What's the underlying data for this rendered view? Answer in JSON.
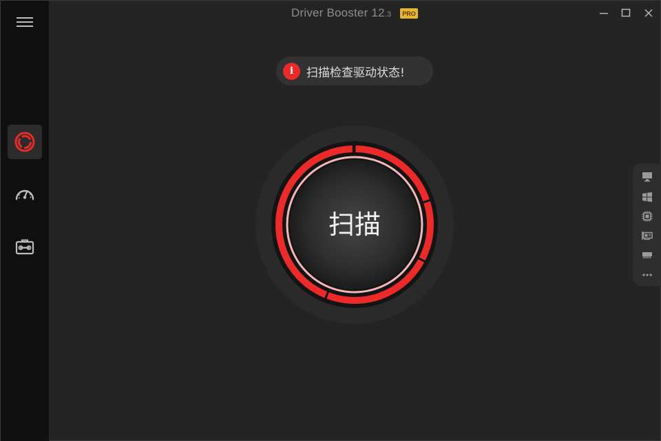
{
  "app": {
    "title_main": "Driver Booster 12",
    "title_version": ".3",
    "badge": "PRO"
  },
  "status": {
    "icon": "i",
    "message": "扫描检查驱动状态!"
  },
  "scan": {
    "label": "扫描"
  },
  "sidebar": {
    "items": [
      {
        "name": "scan-nav",
        "icon": "driver-scan-icon",
        "active": true
      },
      {
        "name": "boost-nav",
        "icon": "speedometer-icon",
        "active": false
      },
      {
        "name": "toolbox-nav",
        "icon": "toolbox-icon",
        "active": false
      }
    ]
  },
  "right_panel": {
    "icons": [
      "monitor-icon",
      "windows-icon",
      "chip-icon",
      "network-card-icon",
      "memory-icon",
      "more-icon"
    ]
  },
  "colors": {
    "accent": "#ec2a2a",
    "ring_inner": "#f5b8b8",
    "badge": "#e8b531",
    "sidebar_bg": "#101010",
    "main_bg": "#242424"
  }
}
